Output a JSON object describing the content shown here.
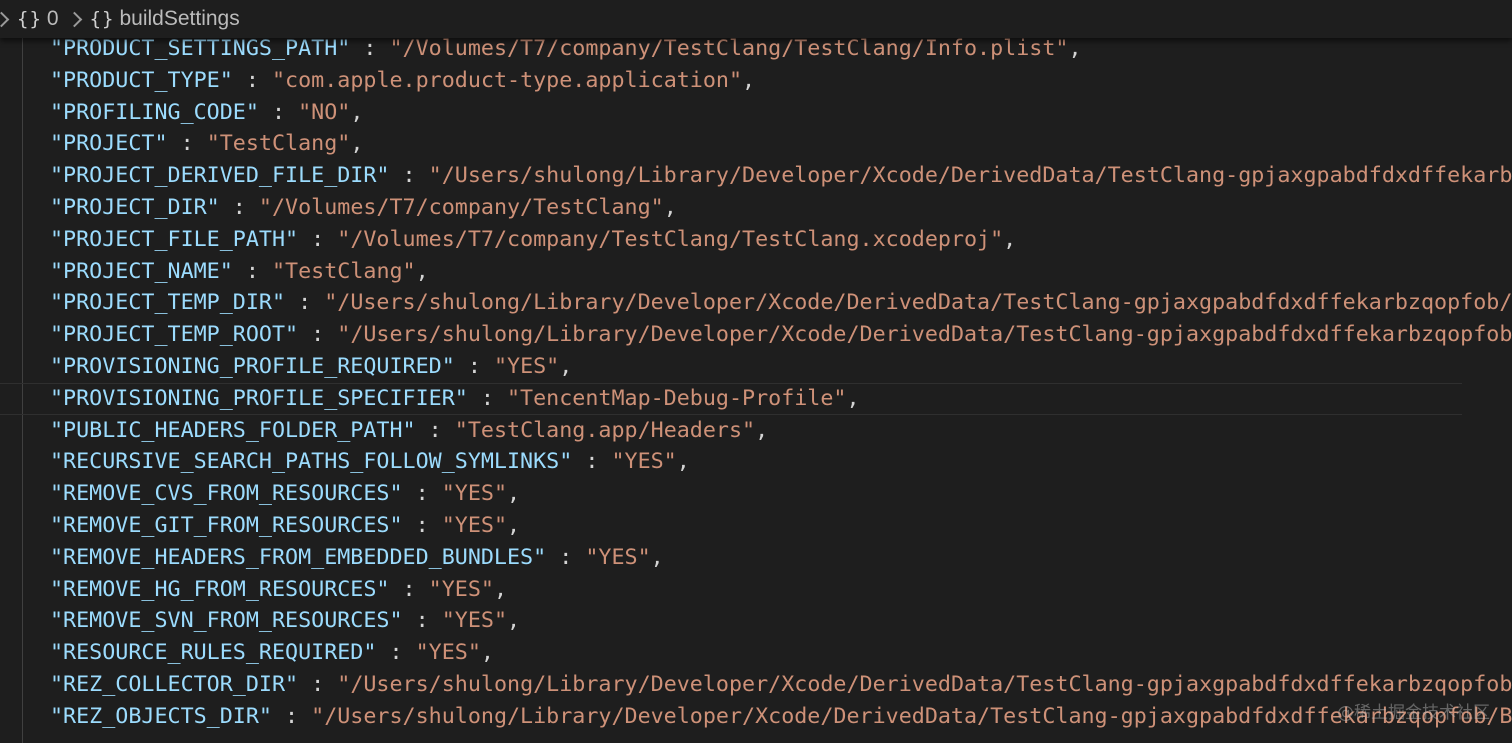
{
  "breadcrumb": {
    "items": [
      {
        "icon": "braces-icon",
        "label": "0"
      },
      {
        "icon": "braces-icon",
        "label": "buildSettings"
      }
    ]
  },
  "code_lines": [
    {
      "key": "\"PRODUCT_SETTINGS_PATH\"",
      "value": "\"/Volumes/T7/company/TestClang/TestClang/Info.plist\"",
      "trail": ","
    },
    {
      "key": "\"PRODUCT_TYPE\"",
      "value": "\"com.apple.product-type.application\"",
      "trail": ","
    },
    {
      "key": "\"PROFILING_CODE\"",
      "value": "\"NO\"",
      "trail": ","
    },
    {
      "key": "\"PROJECT\"",
      "value": "\"TestClang\"",
      "trail": ","
    },
    {
      "key": "\"PROJECT_DERIVED_FILE_DIR\"",
      "value": "\"/Users/shulong/Library/Developer/Xcode/DerivedData/TestClang-gpjaxgpabdfdxdffekarbzqo",
      "trail": ""
    },
    {
      "key": "\"PROJECT_DIR\"",
      "value": "\"/Volumes/T7/company/TestClang\"",
      "trail": ","
    },
    {
      "key": "\"PROJECT_FILE_PATH\"",
      "value": "\"/Volumes/T7/company/TestClang/TestClang.xcodeproj\"",
      "trail": ","
    },
    {
      "key": "\"PROJECT_NAME\"",
      "value": "\"TestClang\"",
      "trail": ","
    },
    {
      "key": "\"PROJECT_TEMP_DIR\"",
      "value": "\"/Users/shulong/Library/Developer/Xcode/DerivedData/TestClang-gpjaxgpabdfdxdffekarbzqopfob/Bui",
      "trail": ""
    },
    {
      "key": "\"PROJECT_TEMP_ROOT\"",
      "value": "\"/Users/shulong/Library/Developer/Xcode/DerivedData/TestClang-gpjaxgpabdfdxdffekarbzqopfob/Bu",
      "trail": ""
    },
    {
      "key": "\"PROVISIONING_PROFILE_REQUIRED\"",
      "value": "\"YES\"",
      "trail": ","
    },
    {
      "key": "\"PROVISIONING_PROFILE_SPECIFIER\"",
      "value": "\"TencentMap-Debug-Profile\"",
      "trail": ","
    },
    {
      "key": "\"PUBLIC_HEADERS_FOLDER_PATH\"",
      "value": "\"TestClang.app/Headers\"",
      "trail": ","
    },
    {
      "key": "\"RECURSIVE_SEARCH_PATHS_FOLLOW_SYMLINKS\"",
      "value": "\"YES\"",
      "trail": ","
    },
    {
      "key": "\"REMOVE_CVS_FROM_RESOURCES\"",
      "value": "\"YES\"",
      "trail": ","
    },
    {
      "key": "\"REMOVE_GIT_FROM_RESOURCES\"",
      "value": "\"YES\"",
      "trail": ","
    },
    {
      "key": "\"REMOVE_HEADERS_FROM_EMBEDDED_BUNDLES\"",
      "value": "\"YES\"",
      "trail": ","
    },
    {
      "key": "\"REMOVE_HG_FROM_RESOURCES\"",
      "value": "\"YES\"",
      "trail": ","
    },
    {
      "key": "\"REMOVE_SVN_FROM_RESOURCES\"",
      "value": "\"YES\"",
      "trail": ","
    },
    {
      "key": "\"RESOURCE_RULES_REQUIRED\"",
      "value": "\"YES\"",
      "trail": ","
    },
    {
      "key": "\"REZ_COLLECTOR_DIR\"",
      "value": "\"/Users/shulong/Library/Developer/Xcode/DerivedData/TestClang-gpjaxgpabdfdxdffekarbzqopfob/Bu",
      "trail": ""
    },
    {
      "key": "\"REZ_OBJECTS_DIR\"",
      "value": "\"/Users/shulong/Library/Developer/Xcode/DerivedData/TestClang-gpjaxgpabdfdxdffekarbzqopfob/Buil",
      "trail": ""
    }
  ],
  "active_line_index": 11,
  "watermark": "@稀土掘金技术社区",
  "colors": {
    "background": "#1e1e1e",
    "key": "#9cdcfe",
    "string": "#ce9178",
    "punctuation": "#d4d4d4"
  }
}
